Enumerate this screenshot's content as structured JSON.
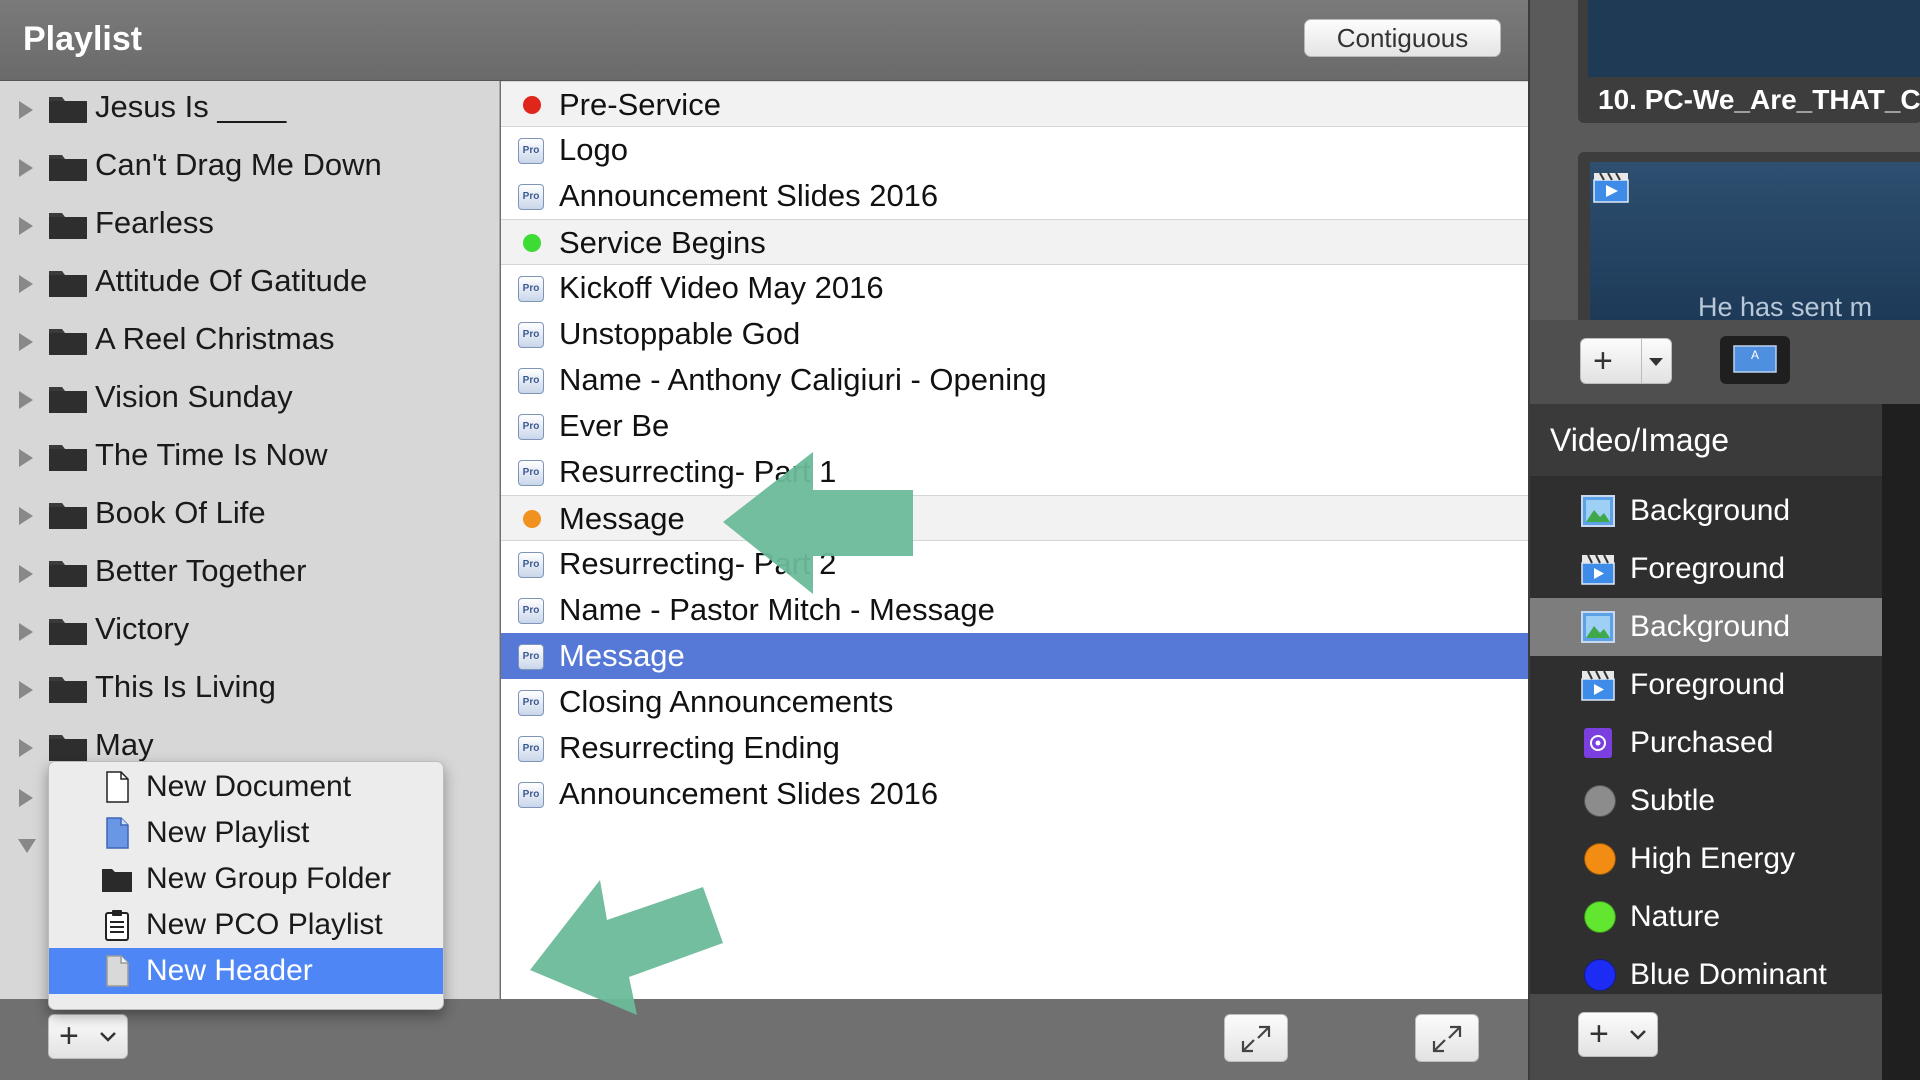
{
  "playlist_header": {
    "title": "Playlist",
    "contiguous_label": "Contiguous"
  },
  "sidebar": {
    "folders": [
      {
        "label": "Jesus Is ____"
      },
      {
        "label": "Can't Drag Me Down"
      },
      {
        "label": "Fearless"
      },
      {
        "label": "Attitude Of Gatitude"
      },
      {
        "label": "A Reel Christmas"
      },
      {
        "label": "Vision Sunday"
      },
      {
        "label": "The Time Is Now"
      },
      {
        "label": "Book Of Life"
      },
      {
        "label": "Better Together"
      },
      {
        "label": "Victory"
      },
      {
        "label": "This Is Living"
      },
      {
        "label": "May"
      }
    ]
  },
  "items": [
    {
      "type": "header",
      "label": "Pre-Service",
      "dot_color": "#e0261b"
    },
    {
      "type": "doc",
      "label": "Logo"
    },
    {
      "type": "doc",
      "label": "Announcement Slides 2016"
    },
    {
      "type": "header",
      "label": "Service Begins",
      "dot_color": "#3ddc34"
    },
    {
      "type": "doc",
      "label": "Kickoff Video May 2016"
    },
    {
      "type": "doc",
      "label": "Unstoppable God"
    },
    {
      "type": "doc",
      "label": "Name - Anthony Caligiuri - Opening"
    },
    {
      "type": "doc",
      "label": "Ever Be"
    },
    {
      "type": "doc",
      "label": "Resurrecting- Part 1"
    },
    {
      "type": "header",
      "label": "Message",
      "dot_color": "#f09120"
    },
    {
      "type": "doc",
      "label": "Resurrecting- Part 2"
    },
    {
      "type": "doc",
      "label": "Name - Pastor Mitch - Message"
    },
    {
      "type": "doc",
      "label": "Message",
      "selected": true
    },
    {
      "type": "doc",
      "label": "Closing Announcements"
    },
    {
      "type": "doc",
      "label": "Resurrecting Ending"
    },
    {
      "type": "doc",
      "label": "Announcement Slides 2016"
    }
  ],
  "context_menu": {
    "items": [
      {
        "label": "New Document",
        "icon": "document-icon"
      },
      {
        "label": "New Playlist",
        "icon": "playlist-icon"
      },
      {
        "label": "New Group Folder",
        "icon": "folder-icon"
      },
      {
        "label": "New PCO Playlist",
        "icon": "clipboard-icon"
      },
      {
        "label": "New Header",
        "icon": "header-icon",
        "selected": true
      }
    ]
  },
  "right_panel": {
    "slide_top_label": "10. PC-We_Are_THAT_C",
    "slide_second_text": "He has sent m",
    "video_image": {
      "title": "Video/Image",
      "items": [
        {
          "label": "Background",
          "icon": "image-icon"
        },
        {
          "label": "Foreground",
          "icon": "video-icon"
        },
        {
          "label": "Background",
          "icon": "image-icon",
          "selected": true
        },
        {
          "label": "Foreground",
          "icon": "video-icon"
        },
        {
          "label": "Purchased",
          "icon": "purchased-icon"
        },
        {
          "label": "Subtle",
          "icon": "dot-icon",
          "color": "#8c8c8c"
        },
        {
          "label": "High Energy",
          "icon": "dot-icon",
          "color": "#f28c12"
        },
        {
          "label": "Nature",
          "icon": "dot-icon",
          "color": "#62e62f"
        },
        {
          "label": "Blue Dominant",
          "icon": "dot-icon",
          "color": "#1d2cf5"
        }
      ]
    }
  },
  "colors": {
    "selection_blue": "#5678d6",
    "menu_highlight": "#4f86f5",
    "annotation_arrow": "#6bbb99"
  }
}
